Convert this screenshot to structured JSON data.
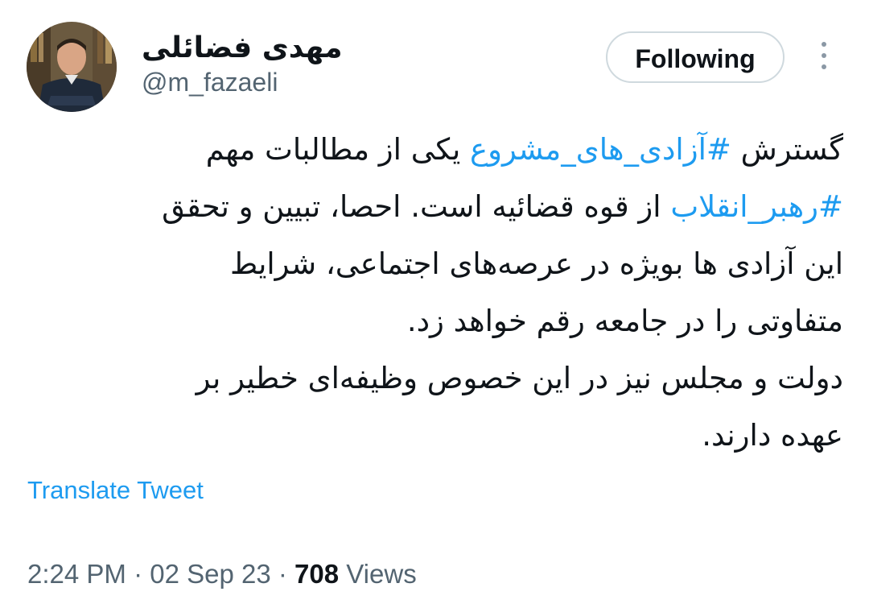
{
  "author": {
    "name": "مهدی فضائلی",
    "handle": "@m_fazaeli"
  },
  "follow_button": {
    "label": "Following"
  },
  "more_menu": {
    "icon": "more-vertical-icon"
  },
  "tweet": {
    "lines": [
      [
        {
          "text": "گسترش ",
          "type": "text"
        },
        {
          "text": "#آزادی_های_مشروع",
          "type": "hashtag"
        },
        {
          "text": " یکی از مطالبات مهم",
          "type": "text"
        }
      ],
      [
        {
          "text": "#رهبر_انقلاب",
          "type": "hashtag"
        },
        {
          "text": " از قوه قضائیه است. احصا، تبیین و تحقق",
          "type": "text"
        }
      ],
      [
        {
          "text": "این آزادی ها بویژه در عرصه‌های اجتماعی، شرایط",
          "type": "text"
        }
      ],
      [
        {
          "text": "متفاوتی را در جامعه رقم خواهد زد.",
          "type": "text"
        }
      ],
      [
        {
          "text": "دولت و مجلس نیز در این خصوص وظیفه‌ای خطیر بر",
          "type": "text"
        }
      ],
      [
        {
          "text": "عهده دارند.",
          "type": "text"
        }
      ]
    ]
  },
  "translate_link": "Translate Tweet",
  "meta": {
    "time": "2:24 PM",
    "separator": " · ",
    "date": "02 Sep 23",
    "views_count": "708",
    "views_label": " Views"
  },
  "colors": {
    "link": "#1d9bf0",
    "text": "#0f1419",
    "secondary": "#536471",
    "border": "#cfd9de"
  }
}
